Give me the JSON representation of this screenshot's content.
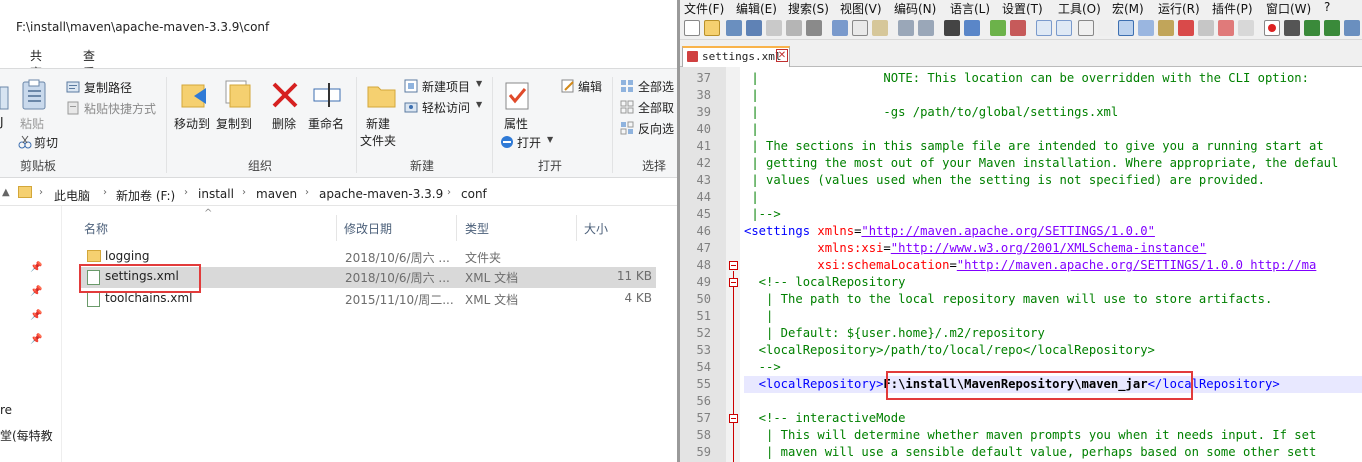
{
  "explorer": {
    "title_path": "F:\\install\\maven\\apache-maven-3.3.9\\conf",
    "tabs": [
      "共享",
      "查看"
    ],
    "ribbon": {
      "clipboard": {
        "label": "剪贴板",
        "copy_path": "复制路径",
        "paste_shortcut": "粘贴快捷方式",
        "paste": "粘贴",
        "cut": "剪切"
      },
      "organize": {
        "label": "组织",
        "move_to": "移动到",
        "copy_to": "复制到",
        "delete": "删除",
        "rename": "重命名"
      },
      "new": {
        "label": "新建",
        "new_item": "新建项目",
        "easy_access": "轻松访问",
        "new_folder_line1": "新建",
        "new_folder_line2": "文件夹"
      },
      "open": {
        "label": "打开",
        "properties": "属性",
        "open": "打开",
        "edit": "编辑"
      },
      "select": {
        "label": "选择",
        "select_all": "全部选",
        "select_none": "全部取",
        "invert": "反向选"
      },
      "partial_left_1": "J",
      "partial_left_2": "e"
    },
    "breadcrumb": [
      "此电脑",
      "新加卷 (F:)",
      "install",
      "maven",
      "apache-maven-3.3.9",
      "conf"
    ],
    "columns": {
      "name": "名称",
      "date": "修改日期",
      "type": "类型",
      "size": "大小"
    },
    "files": [
      {
        "name": "logging",
        "date": "2018/10/6/周六 ...",
        "type": "文件夹",
        "size": ""
      },
      {
        "name": "settings.xml",
        "date": "2018/10/6/周六 ...",
        "type": "XML 文档",
        "size": "11 KB"
      },
      {
        "name": "toolchains.xml",
        "date": "2015/11/10/周二...",
        "type": "XML 文档",
        "size": "4 KB"
      }
    ],
    "left_pane_text_1": "re",
    "left_pane_text_2": "堂(每特教"
  },
  "npp": {
    "menu": [
      "文件(F)",
      "编辑(E)",
      "搜索(S)",
      "视图(V)",
      "编码(N)",
      "语言(L)",
      "设置(T)",
      "工具(O)",
      "宏(M)",
      "运行(R)",
      "插件(P)",
      "窗口(W)",
      "?"
    ],
    "tab_label": "settings.xml",
    "tab_close": "✕",
    "line_numbers": [
      "37",
      "38",
      "39",
      "40",
      "41",
      "42",
      "43",
      "44",
      "45",
      "46",
      "47",
      "48",
      "49",
      "50",
      "51",
      "52",
      "53",
      "54",
      "55",
      "56",
      "57",
      "58",
      "59"
    ],
    "lines": [
      " |                 NOTE: This location can be overridden with the CLI option:",
      " |",
      " |                 -gs /path/to/global/settings.xml",
      " |",
      " | The sections in this sample file are intended to give you a running start at",
      " | getting the most out of your Maven installation. Where appropriate, the defaul",
      " | values (values used when the setting is not specified) are provided.",
      " |",
      " |-->",
      "<settings",
      "          xmlns:xsi=",
      "          xsi:schemaLocation=",
      "  <!-- localRepository",
      "   | The path to the local repository maven will use to store artifacts.",
      "   |",
      "   | Default: ${user.home}/.m2/repository",
      "  <localRepository>/path/to/local/repo</localRepository>",
      "  -->",
      "  <localRepository>",
      "",
      "  <!-- interactiveMode",
      "   | This will determine whether maven prompts you when it needs input. If set",
      "   | maven will use a sensible default value, perhaps based on some other sett"
    ],
    "xmlns_attr": "xmlns",
    "xmlns_val": "\"http://maven.apache.org/SETTINGS/1.0.0\"",
    "xsi_val": "\"http://www.w3.org/2001/XMLSchema-instance\"",
    "schema_val": "\"http://maven.apache.org/SETTINGS/1.0.0 http://ma",
    "eq": "=",
    "local_repo_value": "F:\\install\\MavenRepository\\maven_jar",
    "local_repo_close": "</localRepository>"
  }
}
